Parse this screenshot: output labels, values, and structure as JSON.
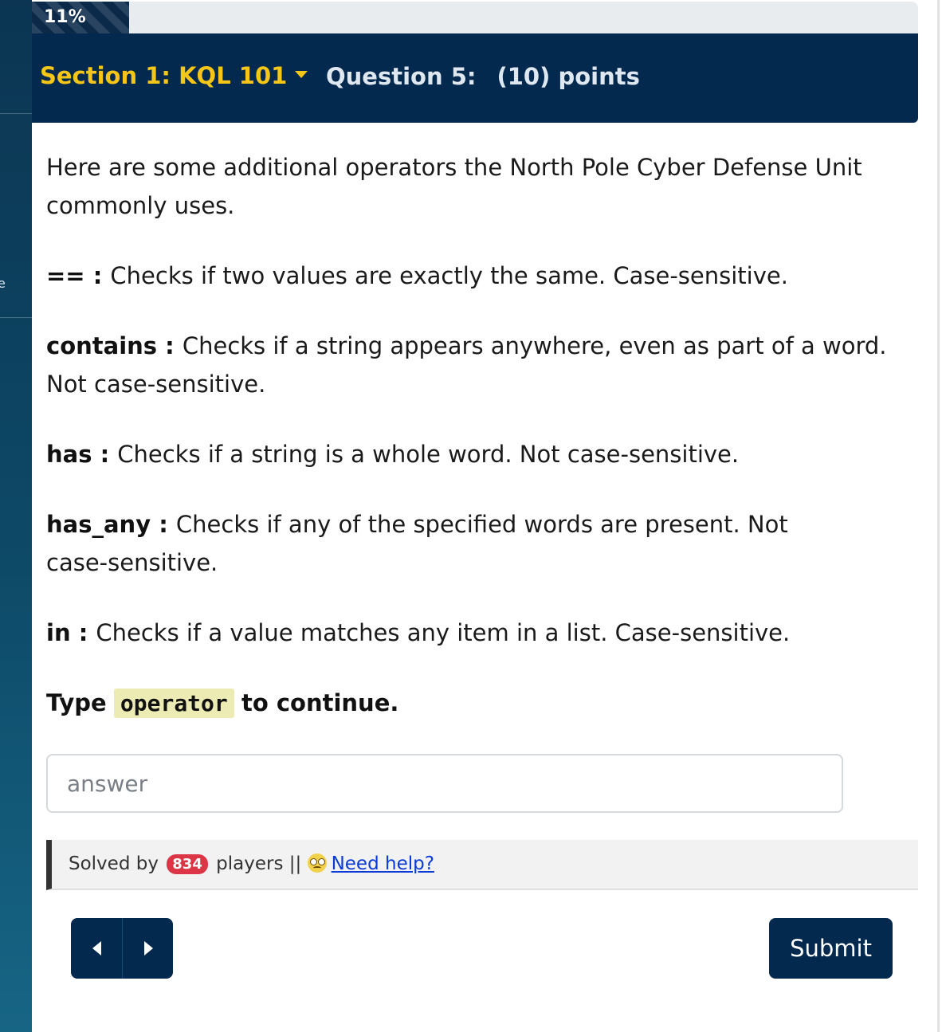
{
  "progress": {
    "label": "11%",
    "fraction": 0.11
  },
  "header": {
    "section_label": "Section 1: KQL 101",
    "question_label": "Question 5:",
    "points_label": "(10) points"
  },
  "content": {
    "intro": "Here are some additional operators the North Pole Cyber Defense Unit commonly uses.",
    "operators": [
      {
        "term": "==",
        "description": "Checks if two values are exactly the same. Case-sensitive."
      },
      {
        "term": "contains",
        "description": "Checks if a string appears anywhere, even as part of a word. Not case-sensitive."
      },
      {
        "term": "has",
        "description": "Checks if a string is a whole word. Not case-sensitive."
      },
      {
        "term": "has_any",
        "description": "Checks if any of the specified words are present. Not case-sensitive."
      },
      {
        "term": "in",
        "description": "Checks if a value matches any item in a list. Case-sensitive."
      }
    ],
    "separator": " : ",
    "instruction_prefix": "Type",
    "instruction_keyword": "operator",
    "instruction_suffix": "to continue."
  },
  "answer_input": {
    "placeholder": "answer",
    "value": ""
  },
  "solved": {
    "prefix": "Solved by",
    "count": "834",
    "suffix": "players",
    "divider": "||",
    "help_icon": "woozy-face-icon",
    "help_label": "Need help?"
  },
  "nav": {
    "prev_icon": "caret-left-icon",
    "next_icon": "caret-right-icon"
  },
  "submit_label": "Submit",
  "colors": {
    "navy": "#04294e",
    "gold": "#f5c518",
    "badge_red": "#dc3545",
    "link_blue": "#0b3ad6",
    "keyword_highlight": "#ecebb3"
  }
}
